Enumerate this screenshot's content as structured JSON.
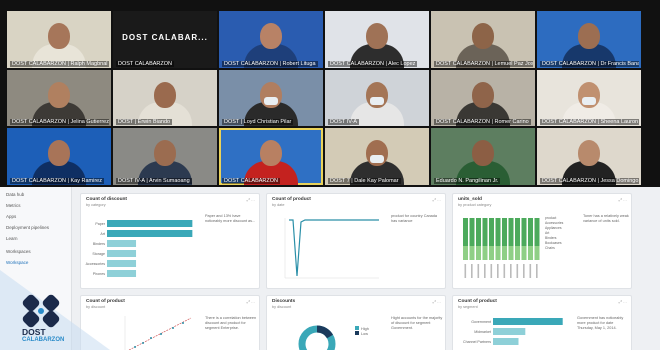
{
  "meeting": {
    "participants": [
      {
        "name": "DOST CALABARZON | Ralph Magbnal",
        "bg": "#d9d4c4",
        "skin": "#a6765a",
        "shirt": "#e8e4d8"
      },
      {
        "name": "DOST CALABARZON",
        "bg": "#1a1a1a",
        "tag": "DOST CALABAR...",
        "host": true
      },
      {
        "name": "DOST CALABARZON | Robert Lituga",
        "bg": "#2a5cb0",
        "skin": "#b88266",
        "shirt": "#1e3f7a"
      },
      {
        "name": "DOST CALABARZON | Alec Lopez",
        "bg": "#e0e3e8",
        "skin": "#9f7256",
        "shirt": "#2d2d2d"
      },
      {
        "name": "DOST CALABARZON | Lemuel Paz Josef",
        "bg": "#c9c2b2",
        "skin": "#8d6448",
        "shirt": "#6b6358"
      },
      {
        "name": "DOST CALABARZON | Dr Francis Banaaba",
        "bg": "#2d6cc0",
        "skin": "#9c6e52",
        "shirt": "#17386b"
      },
      {
        "name": "DOST CALABARZON | Jelina Gutierrez",
        "bg": "#8e8a80",
        "skin": "#b08060",
        "shirt": "#3d3a36"
      },
      {
        "name": "DOST | Erwin Biando",
        "bg": "#d6d2c8",
        "skin": "#9a6a4e",
        "shirt": "#e4e0d6"
      },
      {
        "name": "DOST | Loyd Christian Pilar",
        "bg": "#7a8fa8",
        "skin": "#b07e60",
        "shirt": "#2a2a2a",
        "mask": true
      },
      {
        "name": "DOST IV-A",
        "bg": "#cfd3d8",
        "skin": "#a47556",
        "shirt": "#e6e6e6",
        "mask": true
      },
      {
        "name": "DOST CALABARZON | Romer Carino",
        "bg": "#b8b2a6",
        "skin": "#8f644a",
        "shirt": "#3a3834"
      },
      {
        "name": "DOST CALABARZON | Sheena Lauron",
        "bg": "#e8e4dc",
        "skin": "#c09070",
        "shirt": "#f0ece6",
        "mask": true
      },
      {
        "name": "DOST CALABARZON | Kay Ramirez",
        "bg": "#1d5fb8",
        "skin": "#a87458",
        "shirt": "#0f2f63"
      },
      {
        "name": "DOST IV-A | Arvin Sumaoang",
        "bg": "#8a8a86",
        "skin": "#9b6c50",
        "shirt": "#2c3a50"
      },
      {
        "name": "DOST CALABARZON",
        "bg": "#2f70c4",
        "skin": "#b88062",
        "shirt": "#c4221f",
        "active": true
      },
      {
        "name": "DOST 7 | Dale Kay Palomar",
        "bg": "#d3cbb6",
        "skin": "#a06e50",
        "shirt": "#2e2e2e",
        "mask": true
      },
      {
        "name": "Eduardo N. Pangilinan Jr.",
        "bg": "#5d7e60",
        "skin": "#8c5e44",
        "shirt": "#2a5e34"
      },
      {
        "name": "DOST CALABARZON | Jessa Domingo",
        "bg": "#ded8cc",
        "skin": "#b88a6c",
        "shirt": "#222222"
      }
    ]
  },
  "sidebar": {
    "items": [
      "Data hub",
      "Metrics",
      "Apps",
      "Deployment pipelines",
      "Learn",
      "Workspaces",
      "Workspace"
    ]
  },
  "cards": {
    "c1": {
      "title": "Count of discount",
      "sub": "by category",
      "note": "Paper and 13% have noticeably more discount as...",
      "values": [
        97,
        97,
        33,
        33,
        33,
        33
      ],
      "labels": [
        "Paper",
        "Art",
        "Binders",
        "Storage",
        "Accessories",
        "Phones"
      ]
    },
    "c2": {
      "title": "Count of product",
      "sub": "by date",
      "note": "product for country Canada has variance"
    },
    "c3": {
      "title": "units_sold",
      "sub": "by product category",
      "note": "Toner has a relatively weak variance of units sold.",
      "legend": [
        "product",
        "Accessories",
        "Appliances",
        "Art",
        "Binders",
        "Bookcases",
        "Chairs"
      ]
    },
    "c4": {
      "title": "Count of product",
      "sub": "by discount",
      "note": "There is a correlation between discount and product for segment Enterprise."
    },
    "c5": {
      "title": "Discounts",
      "sub": "by discount",
      "note": "Hight accounts for the majority of discount for segment Government.",
      "legend": [
        "High",
        "Low"
      ]
    },
    "c6": {
      "title": "Count of product",
      "sub": "by segment",
      "note": "Government has noticeably more product for date Thursday, May 1, 2014.",
      "values": [
        82,
        38,
        30
      ],
      "labels": [
        "Government",
        "Midmarket",
        "Channel Partners"
      ]
    }
  },
  "logo": {
    "name": "DOST",
    "region": "CALABARZON"
  },
  "colors": {
    "accent": "#1b6fb8",
    "bar": "#3aa8b8",
    "bar_light": "#8ed0d8",
    "green": "#8fcf86",
    "green_dark": "#4caa5c"
  }
}
